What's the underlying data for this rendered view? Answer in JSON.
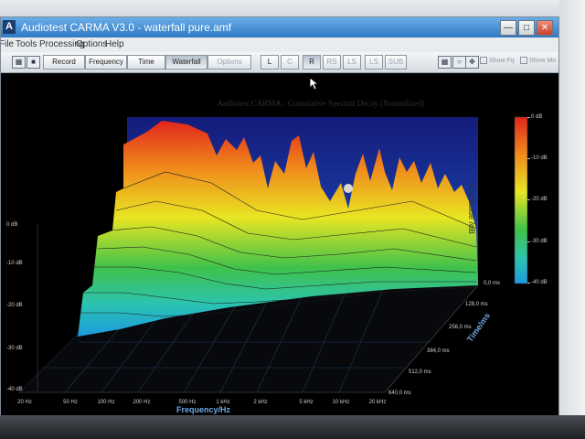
{
  "window": {
    "title": "Audiotest CARMA V3.0 - waterfall pure.amf",
    "app_icon": "A",
    "controls": [
      "minimize-icon",
      "maximize-icon",
      "close-icon"
    ]
  },
  "menu": [
    "File",
    "Tools",
    "Processing",
    "Options",
    "Help"
  ],
  "toolbar": {
    "tabs": [
      "Record",
      "Frequency",
      "Time",
      "Waterfall",
      "Options"
    ],
    "active_tab": "Waterfall",
    "view_buttons": [
      "L",
      "C",
      "R",
      "RS",
      "LS",
      "LS",
      "SUB"
    ],
    "checks": [
      "Show Fq",
      "Show Mo"
    ]
  },
  "plot": {
    "title": "Audiotest CARMA - Cumulative Spectral Decay (Normalized)",
    "amplitude_label": "Amplitude /dB",
    "colorbar": {
      "labels": [
        "0 dB",
        "-10 dB",
        "-20 dB",
        "-30 dB",
        "-40 dB"
      ],
      "colors": [
        "#e0261b",
        "#f08a1c",
        "#e8e622",
        "#3fc24a",
        "#1b9be0"
      ]
    },
    "y_axis": [
      "0 dB",
      "-10 dB",
      "-20 dB",
      "-30 dB",
      "-40 dB"
    ],
    "x_axis": {
      "title": "Frequency/Hz",
      "ticks": [
        "20 Hz",
        "50 Hz",
        "100 Hz",
        "200 Hz",
        "500 Hz",
        "1 kHz",
        "2 kHz",
        "5 kHz",
        "10 kHz",
        "20 kHz"
      ]
    },
    "time_axis": {
      "title": "Time/ms",
      "ticks": [
        "0,0 ms",
        "128,0 ms",
        "256,0 ms",
        "384,0 ms",
        "512,0 ms",
        "640,0 ms"
      ]
    },
    "accent": "#6fa8e6"
  }
}
